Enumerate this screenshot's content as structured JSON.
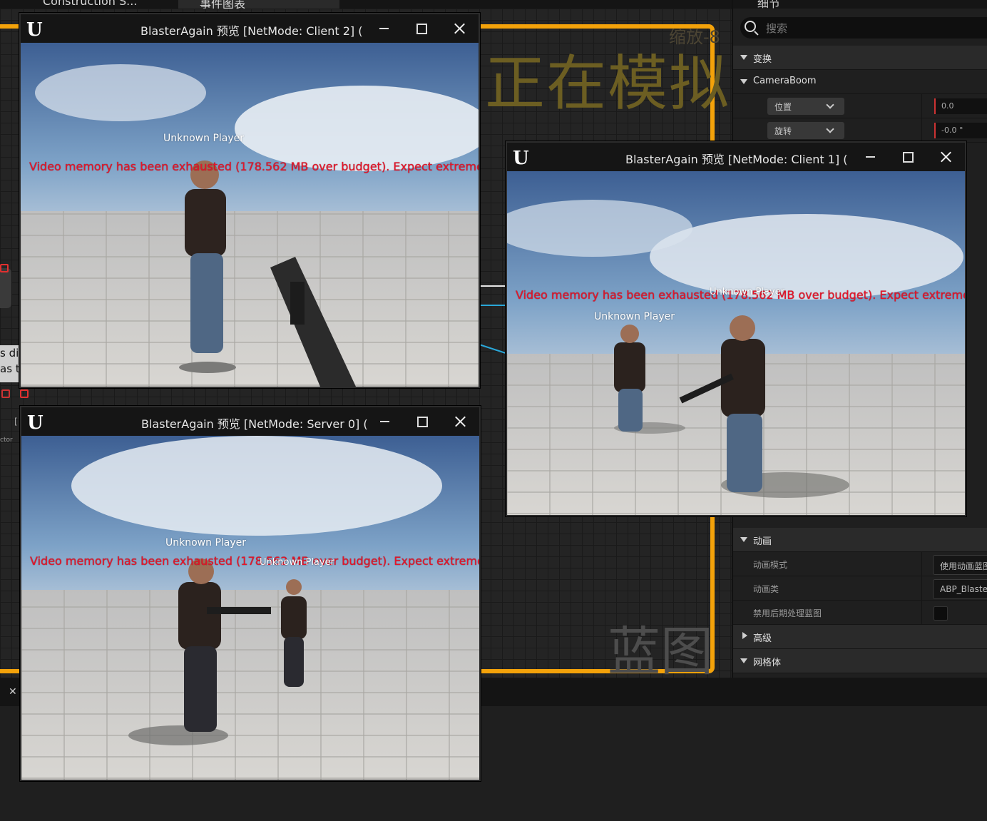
{
  "editor": {
    "tabs": [
      "Construction S...",
      "事件图表"
    ],
    "simulating_label": "正在模拟",
    "zoom_label": "缩放-8",
    "blueprint_watermark": "蓝图",
    "node_fragment_line1": "s dis",
    "node_fragment_line2": "as to",
    "actor_fragment": "ctor",
    "bracket_fragment": "[",
    "accent_color": "#f3a20a"
  },
  "details": {
    "header": "细节",
    "search_placeholder": "搜索",
    "rows": {
      "transform": "变换",
      "component": "CameraBoom",
      "location_label": "位置",
      "location_value": "0.0",
      "rotation_label": "旋转",
      "rotation_value": "-0.0 °",
      "animation": "动画",
      "anim_mode_label": "动画模式",
      "anim_mode_value": "使用动画蓝图",
      "anim_class_label": "动画类",
      "anim_class_value": "ABP_Blaster",
      "disable_post_label": "禁用后期处理蓝图",
      "advanced": "高级",
      "mesh": "网格体"
    }
  },
  "windows": {
    "client2": {
      "title": "BlasterAgain 预览 [NetMode: Client 2]  (",
      "warning": "Video memory has been exhausted (178.562 MB over budget). Expect extremely p",
      "labels": [
        "Unknown Player"
      ]
    },
    "server0": {
      "title": "BlasterAgain 预览 [NetMode: Server 0]  (",
      "warning": "Video memory has been exhausted (178.562 MB over budget). Expect extremely p",
      "labels": [
        "Unknown Player",
        "Unknown Player"
      ]
    },
    "client1": {
      "title": "BlasterAgain 预览 [NetMode: Client 1]  (",
      "warning": "Video memory has been exhausted (178.562 MB over budget). Expect extremely p",
      "labels": [
        "Unknown Player",
        "Unknown Player"
      ]
    }
  }
}
